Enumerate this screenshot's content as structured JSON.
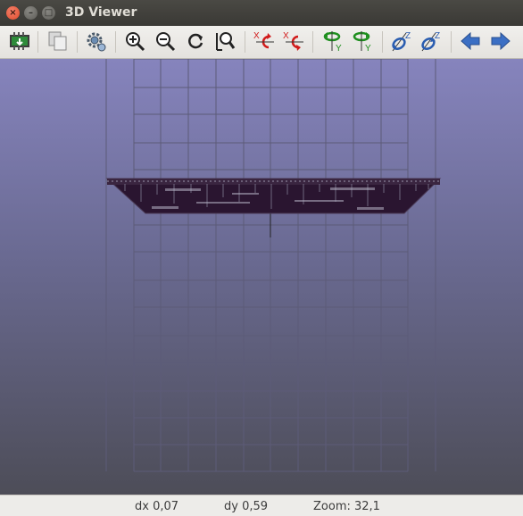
{
  "window": {
    "title": "3D Viewer"
  },
  "toolbar": {
    "buttons": [
      {
        "name": "reload-board-button",
        "icon": "reload-board-icon"
      },
      {
        "name": "copy-to-clipboard-button",
        "icon": "copy-icon"
      },
      {
        "name": "settings-button",
        "icon": "gear-icon"
      },
      {
        "name": "zoom-in-button",
        "icon": "zoom-in-icon"
      },
      {
        "name": "zoom-out-button",
        "icon": "zoom-out-icon"
      },
      {
        "name": "redraw-button",
        "icon": "redraw-icon"
      },
      {
        "name": "zoom-fit-button",
        "icon": "zoom-fit-icon"
      },
      {
        "name": "rotate-x-cw-button",
        "icon": "rotate-x-icon"
      },
      {
        "name": "rotate-x-ccw-button",
        "icon": "rotate-x-icon"
      },
      {
        "name": "rotate-y-cw-button",
        "icon": "rotate-y-icon"
      },
      {
        "name": "rotate-y-ccw-button",
        "icon": "rotate-y-icon"
      },
      {
        "name": "rotate-z-cw-button",
        "icon": "rotate-z-icon"
      },
      {
        "name": "rotate-z-ccw-button",
        "icon": "rotate-z-icon"
      },
      {
        "name": "move-left-button",
        "icon": "arrow-left-icon"
      },
      {
        "name": "move-right-button",
        "icon": "arrow-right-icon"
      }
    ],
    "axis_labels": {
      "x": "X",
      "y": "Y",
      "z": "Z"
    }
  },
  "colors": {
    "rotate_x": "#d11a1a",
    "rotate_y": "#1f8f1f",
    "rotate_z": "#2a5db0",
    "arrows": "#3b6fc4",
    "board": "#2a1530"
  },
  "status": {
    "dx": "dx 0,07",
    "dy": "dy 0,59",
    "zoom": "Zoom: 32,1"
  }
}
